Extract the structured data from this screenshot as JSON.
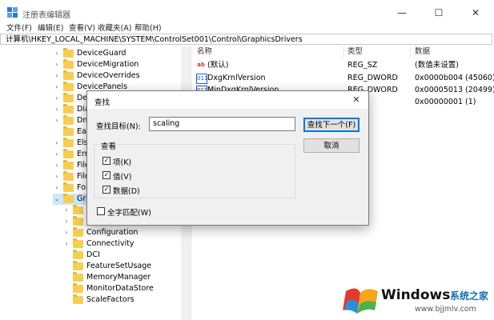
{
  "window": {
    "title": "注册表编辑器",
    "minimize": "—",
    "maximize": "☐",
    "close": "✕"
  },
  "menu": [
    "文件(F)",
    "编辑(E)",
    "查看(V)",
    "收藏夹(A)",
    "帮助(H)"
  ],
  "address": "计算机\\HKEY_LOCAL_MACHINE\\SYSTEM\\ControlSet001\\Control\\GraphicsDrivers",
  "tree": [
    {
      "label": "DeviceGuard",
      "expander": "›"
    },
    {
      "label": "DeviceMigration",
      "expander": "›"
    },
    {
      "label": "DeviceOverrides",
      "expander": "›"
    },
    {
      "label": "DevicePanels",
      "expander": "›"
    },
    {
      "label": "DevC",
      "expander": "›"
    },
    {
      "label": "Diagn",
      "expander": "›"
    },
    {
      "label": "Dmaf",
      "expander": "›"
    },
    {
      "label": "Early",
      "expander": ""
    },
    {
      "label": "Els",
      "expander": "›"
    },
    {
      "label": "Errat",
      "expander": "›"
    },
    {
      "label": "FileSy",
      "expander": "›"
    },
    {
      "label": "FileSy",
      "expander": "›"
    },
    {
      "label": "FontA",
      "expander": "›"
    },
    {
      "label": "Grap",
      "expander": "⌄"
    },
    {
      "label": "Ad",
      "expander": "›"
    },
    {
      "label": "Bl",
      "expander": "›"
    },
    {
      "label": "Configuration",
      "expander": "›"
    },
    {
      "label": "Connectivity",
      "expander": "›"
    },
    {
      "label": "DCI",
      "expander": ""
    },
    {
      "label": "FeatureSetUsage",
      "expander": ""
    },
    {
      "label": "MemoryManager",
      "expander": ""
    },
    {
      "label": "MonitorDataStore",
      "expander": ""
    },
    {
      "label": "ScaleFactors",
      "expander": ""
    }
  ],
  "columns": {
    "name": "名称",
    "type": "类型",
    "data": "数据"
  },
  "values": [
    {
      "icon": "ab",
      "name": "(默认)",
      "type": "REG_SZ",
      "data": "(数值未设置)"
    },
    {
      "icon": "011",
      "name": "DxgKrnlVersion",
      "type": "REG_DWORD",
      "data": "0x0000b004 (45060)"
    },
    {
      "icon": "011",
      "name": "MinDxgKrnlVersion",
      "type": "REG_DWORD",
      "data": "0x00005013 (20499)"
    },
    {
      "icon": "011",
      "name": "",
      "type": "",
      "data": "0x00000001 (1)"
    }
  ],
  "find": {
    "title": "查找",
    "close": "✕",
    "target_label": "查找目标(N):",
    "target_value": "scaling",
    "find_next": "查找下一个(F)",
    "cancel": "取消",
    "look_in": "查看",
    "opt_keys": "项(K)",
    "opt_values": "值(V)",
    "opt_data": "数据(D)",
    "match_whole": "全字匹配(W)",
    "check": "✓"
  },
  "watermark": {
    "brand": "Windows",
    "suffix": "系统之家",
    "url": "www.bjjmlv.com"
  },
  "colors": {
    "accent": "#0078d7",
    "folder": "#f7ce55",
    "title_gray": "#555555"
  }
}
